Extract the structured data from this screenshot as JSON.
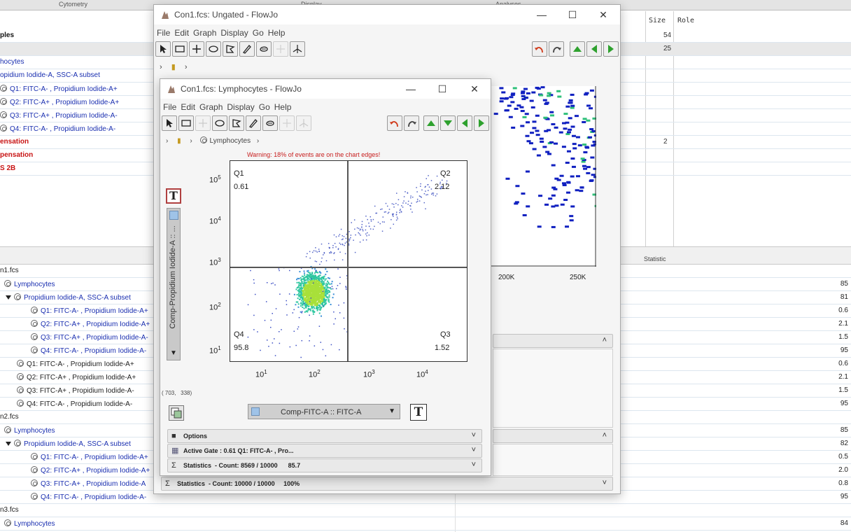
{
  "background": {
    "header_cols": [
      "Cytometry",
      "Display",
      "Analyses"
    ],
    "col_heads": {
      "size": "Size",
      "role": "Role"
    },
    "top_rows": [
      {
        "label": "ples",
        "style": "black",
        "indent": 0,
        "size": "54"
      },
      {
        "label": "",
        "style": "norm",
        "indent": 0,
        "size": "25",
        "highlight": true
      },
      {
        "label": "hocytes",
        "style": "blue",
        "indent": 0,
        "size": ""
      },
      {
        "label": "opidium Iodide-A, SSC-A subset",
        "style": "blue",
        "indent": 0,
        "size": ""
      },
      {
        "label": "Q1: FITC-A- , Propidium Iodide-A+",
        "style": "blue",
        "indent": 0,
        "size": "",
        "icon": true
      },
      {
        "label": "Q2: FITC-A+ , Propidium Iodide-A+",
        "style": "blue",
        "indent": 0,
        "size": "",
        "icon": true
      },
      {
        "label": "Q3: FITC-A+ , Propidium Iodide-A-",
        "style": "blue",
        "indent": 0,
        "size": "",
        "icon": true
      },
      {
        "label": "Q4: FITC-A- , Propidium Iodide-A-",
        "style": "blue",
        "indent": 0,
        "size": "",
        "icon": true
      },
      {
        "label": "ensation",
        "style": "red",
        "indent": 0,
        "size": "2"
      },
      {
        "label": "pensation",
        "style": "red",
        "indent": 0,
        "size": ""
      },
      {
        "label": "S 2B",
        "style": "red",
        "indent": 0,
        "size": ""
      }
    ],
    "statistic_header": "Statistic",
    "bottom_rows": [
      {
        "label": "n1.fcs",
        "style": "norm",
        "indent": 0,
        "val": ""
      },
      {
        "label": "Lymphocytes",
        "style": "blue",
        "indent": 6,
        "icon": true,
        "val": "85"
      },
      {
        "label": "Propidium Iodide-A, SSC-A subset",
        "style": "blue",
        "indent": 8,
        "icon": true,
        "tri": true,
        "val": "81"
      },
      {
        "label": "Q1: FITC-A- , Propidium Iodide-A+",
        "style": "blue",
        "indent": 44,
        "icon": true,
        "val": "0.6"
      },
      {
        "label": "Q2: FITC-A+ , Propidium Iodide-A+",
        "style": "blue",
        "indent": 44,
        "icon": true,
        "val": "2.1"
      },
      {
        "label": "Q3: FITC-A+ , Propidium Iodide-A-",
        "style": "blue",
        "indent": 44,
        "icon": true,
        "val": "1.5"
      },
      {
        "label": "Q4: FITC-A- , Propidium Iodide-A-",
        "style": "blue",
        "indent": 44,
        "icon": true,
        "val": "95"
      },
      {
        "label": "Q1: FITC-A- , Propidium Iodide-A+",
        "style": "norm",
        "indent": 24,
        "icon": true,
        "val": "0.6"
      },
      {
        "label": "Q2: FITC-A+ , Propidium Iodide-A+",
        "style": "norm",
        "indent": 24,
        "icon": true,
        "val": "2.1"
      },
      {
        "label": "Q3: FITC-A+ , Propidium Iodide-A-",
        "style": "norm",
        "indent": 24,
        "icon": true,
        "val": "1.5"
      },
      {
        "label": "Q4: FITC-A- , Propidium Iodide-A-",
        "style": "norm",
        "indent": 24,
        "icon": true,
        "val": "95"
      },
      {
        "label": "n2.fcs",
        "style": "norm",
        "indent": 0,
        "val": ""
      },
      {
        "label": "Lymphocytes",
        "style": "blue",
        "indent": 6,
        "icon": true,
        "val": "85"
      },
      {
        "label": "Propidium Iodide-A, SSC-A subset",
        "style": "blue",
        "indent": 8,
        "icon": true,
        "tri": true,
        "val": "82"
      },
      {
        "label": "Q1: FITC-A- , Propidium Iodide-A+",
        "style": "blue",
        "indent": 44,
        "icon": true,
        "val": "0.5"
      },
      {
        "label": "Q2: FITC-A+ , Propidium Iodide-A+",
        "style": "blue",
        "indent": 44,
        "icon": true,
        "val": "2.0"
      },
      {
        "label": "Q3: FITC-A+ , Propidium Iodide-A",
        "style": "blue",
        "indent": 44,
        "icon": true,
        "val": "0.8"
      },
      {
        "label": "Q4: FITC-A- , Propidium Iodide-A-",
        "style": "blue",
        "indent": 44,
        "icon": true,
        "val": "95"
      },
      {
        "label": "n3.fcs",
        "style": "norm",
        "indent": 0,
        "val": ""
      },
      {
        "label": "Lymphocytes",
        "style": "blue",
        "indent": 6,
        "icon": true,
        "val": "84"
      }
    ]
  },
  "window_back": {
    "title": "Con1.fcs: Ungated - FlowJo",
    "menu": [
      "File",
      "Edit",
      "Graph",
      "Display",
      "Go",
      "Help"
    ],
    "x_ticks": [
      "200K",
      "250K"
    ],
    "statistics_bar": {
      "label": "Statistics",
      "text": "Count: 10000 / 10000",
      "pct": "100%"
    }
  },
  "window_front": {
    "title": "Con1.fcs: Lymphocytes - FlowJo",
    "menu": [
      "File",
      "Edit",
      "Graph",
      "Display",
      "Go",
      "Help"
    ],
    "breadcrumb": "Lymphocytes",
    "warning": "Warning: 18% of events are on the chart edges!",
    "quadrants": [
      {
        "name": "Q1",
        "value": "0.61"
      },
      {
        "name": "Q2",
        "value": "2.12"
      },
      {
        "name": "Q3",
        "value": "1.52"
      },
      {
        "name": "Q4",
        "value": "95.8"
      }
    ],
    "y_axis_label": "Comp-Propidium Iodide-A :: ...",
    "x_axis_label": "Comp-FITC-A :: FITC-A",
    "y_ticks": [
      "5",
      "4",
      "3",
      "2",
      "1"
    ],
    "x_ticks": [
      "1",
      "2",
      "3",
      "4"
    ],
    "tick_base": "10",
    "coords": "( 703,   338)",
    "panels": [
      {
        "label": "Options",
        "text": ""
      },
      {
        "label": "Active Gate",
        "text": ": 0.61 Q1: FITC-A- , Pro..."
      },
      {
        "label": "Statistics",
        "text": "- Count: 8569 / 10000      85.7"
      }
    ],
    "text_button": "T"
  },
  "colors": {
    "blue_text": "#1a2fb0",
    "red_text": "#c81414",
    "warning": "#c81e1e",
    "green_arrow": "#2ea12e",
    "red_arrow": "#d03a1a"
  }
}
